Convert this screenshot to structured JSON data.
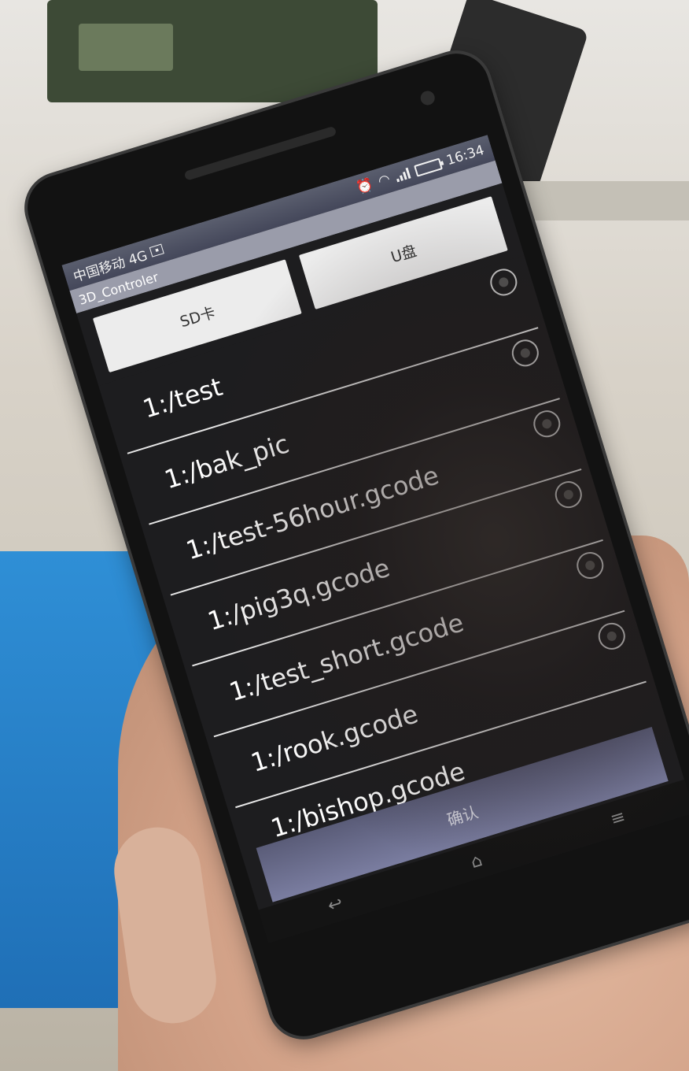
{
  "status_bar": {
    "carrier": "中国移动 4G",
    "time": "16:34",
    "icons": [
      "alarm-icon",
      "wifi-icon",
      "signal-icon",
      "battery-icon"
    ]
  },
  "app": {
    "title": "3D_Controler"
  },
  "tabs": [
    {
      "label": "SD卡"
    },
    {
      "label": "U盘"
    }
  ],
  "files": [
    {
      "name": "1:/test"
    },
    {
      "name": "1:/bak_pic"
    },
    {
      "name": "1:/test-56hour.gcode"
    },
    {
      "name": "1:/pig3q.gcode"
    },
    {
      "name": "1:/test_short.gcode"
    },
    {
      "name": "1:/rook.gcode"
    },
    {
      "name": "1:/bishop.gcode"
    }
  ],
  "confirm_label": "确认",
  "colors": {
    "accent": "#6a6d8c",
    "status_bar": "#44475a",
    "title_bar": "#9a9caa"
  }
}
